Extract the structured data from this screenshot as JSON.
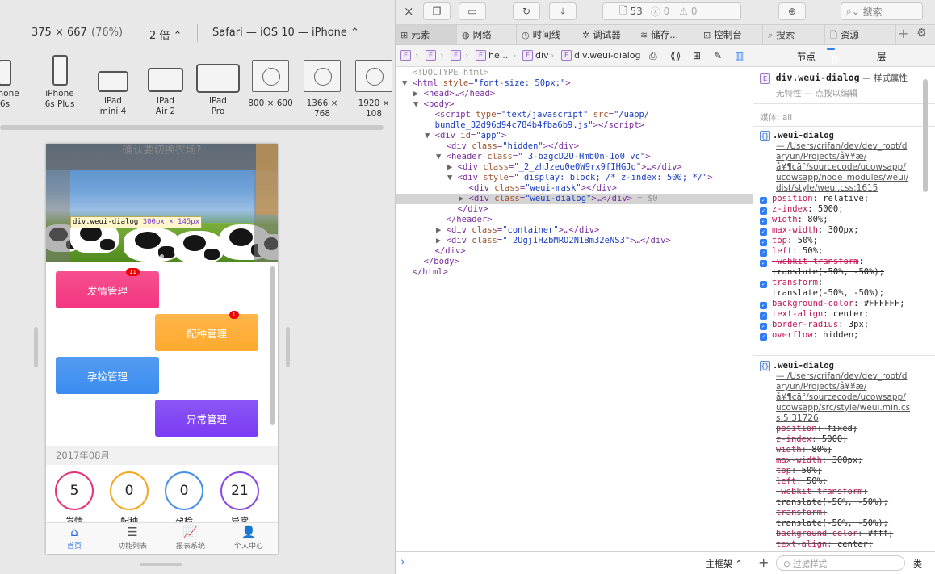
{
  "left": {
    "resolution": "375 × 667",
    "zoom_pct": "(76%)",
    "scale": "2 倍",
    "browser": "Safari — iOS 10 — iPhone",
    "devices": [
      {
        "line1": "iPhone",
        "line2": "6s"
      },
      {
        "line1": "iPhone",
        "line2": "6s Plus"
      },
      {
        "line1": "iPad",
        "line2": "mini 4"
      },
      {
        "line1": "iPad",
        "line2": "Air 2"
      },
      {
        "line1": "iPad",
        "line2": "Pro"
      },
      {
        "line1": "800 × 600",
        "line2": ""
      },
      {
        "line1": "1366 × 768",
        "line2": ""
      },
      {
        "line1": "1920 × 108",
        "line2": ""
      }
    ]
  },
  "phone": {
    "dialog_text": "确认要切换农场?",
    "highlight_tag": {
      "name": "div.weui-dialog",
      "size": "300px × 145px"
    },
    "buttons": [
      {
        "label": "发情管理",
        "badge": "11",
        "color": "#f4357f"
      },
      {
        "label": "配种管理",
        "badge": "1",
        "color": "#ffaa2e"
      },
      {
        "label": "孕检管理",
        "badge": "",
        "color": "#3a8cf0"
      },
      {
        "label": "异常管理",
        "badge": "",
        "color": "#7a3cf4"
      }
    ],
    "month": "2017年08月",
    "stats": [
      {
        "value": "5",
        "label": "发情",
        "color": "#e4357a"
      },
      {
        "value": "0",
        "label": "配种",
        "color": "#f5a623"
      },
      {
        "value": "0",
        "label": "孕检",
        "color": "#4a90e2"
      },
      {
        "value": "21",
        "label": "异常",
        "color": "#8a4ae6"
      }
    ],
    "tabs": [
      {
        "label": "首页",
        "icon": "home-icon",
        "glyph": "⌂",
        "active": true
      },
      {
        "label": "功能列表",
        "icon": "list-icon",
        "glyph": "☰",
        "active": false
      },
      {
        "label": "报表系统",
        "icon": "chart-icon",
        "glyph": "📈",
        "active": false
      },
      {
        "label": "个人中心",
        "icon": "user-icon",
        "glyph": "👤",
        "active": false
      }
    ]
  },
  "inspector": {
    "resources_count": "53",
    "errors": "0",
    "warnings": "0",
    "search_placeholder": "搜索",
    "tabs": [
      "元素",
      "网络",
      "时间线",
      "调试器",
      "储存...",
      "控制台",
      "搜索",
      "资源"
    ],
    "breadcrumbs": [
      "he...",
      "div",
      "div.weui-dialog"
    ],
    "dom_lines": [
      {
        "indent": 0,
        "tri": "",
        "html": "<span class='cm'>&lt;!DOCTYPE html&gt;</span>"
      },
      {
        "indent": 0,
        "tri": "▼",
        "html": "&lt;html <span class='att'>style</span>=<span class='val'>\"font-size: 50px;\"</span>&gt;"
      },
      {
        "indent": 1,
        "tri": "▶",
        "html": "&lt;head&gt;…&lt;/head&gt;"
      },
      {
        "indent": 1,
        "tri": "▼",
        "html": "&lt;body&gt;"
      },
      {
        "indent": 2,
        "tri": "",
        "html": "&lt;script <span class='att'>type</span>=<span class='val'>\"text/javascript\"</span> <span class='att'>src</span>=<span class='val'>\"/uapp/</span>"
      },
      {
        "indent": 2,
        "tri": "",
        "html": "<span class='val'>bundle_32d96d94c784b4fba6b9.js\"</span>&gt;&lt;/script&gt;"
      },
      {
        "indent": 2,
        "tri": "▼",
        "html": "&lt;div <span class='att'>id</span>=<span class='val'>\"app\"</span>&gt;"
      },
      {
        "indent": 3,
        "tri": "",
        "html": "&lt;div <span class='att'>class</span>=<span class='val'>\"hidden\"</span>&gt;&lt;/div&gt;"
      },
      {
        "indent": 3,
        "tri": "▼",
        "html": "&lt;header <span class='att'>class</span>=<span class='val'>\"_3-bzgcD2U-Hmb0n-1o0_vc\"</span>&gt;"
      },
      {
        "indent": 4,
        "tri": "▶",
        "html": "&lt;div <span class='att'>class</span>=<span class='val'>\"_2_zhJzeu0e0W9rx9fIHGJd\"</span>&gt;…&lt;/div&gt;"
      },
      {
        "indent": 4,
        "tri": "▼",
        "html": "&lt;div <span class='att'>style</span>=<span class='val'>\" display: block; /* z-index: 500; */\"</span>&gt;"
      },
      {
        "indent": 5,
        "tri": "",
        "html": "&lt;div <span class='att'>class</span>=<span class='val'>\"weui-mask\"</span>&gt;&lt;/div&gt;"
      },
      {
        "indent": 5,
        "tri": "▶",
        "html": "&lt;div <span class='att'>class</span>=<span class='val'>\"weui-dialog\"</span>&gt;…&lt;/div&gt; <span class='cm'>= $0</span>",
        "selected": true
      },
      {
        "indent": 4,
        "tri": "",
        "html": "&lt;/div&gt;"
      },
      {
        "indent": 3,
        "tri": "",
        "html": "&lt;/header&gt;"
      },
      {
        "indent": 3,
        "tri": "▶",
        "html": "&lt;div <span class='att'>class</span>=<span class='val'>\"container\"</span>&gt;…&lt;/div&gt;"
      },
      {
        "indent": 3,
        "tri": "▶",
        "html": "&lt;div <span class='att'>class</span>=<span class='val'>\"_2UgjIHZbMRO2N1Bm32eNS3\"</span>&gt;…&lt;/div&gt;"
      },
      {
        "indent": 2,
        "tri": "",
        "html": "&lt;/div&gt;"
      },
      {
        "indent": 1,
        "tri": "",
        "html": "&lt;/body&gt;"
      },
      {
        "indent": 0,
        "tri": "",
        "html": "&lt;/html&gt;"
      }
    ],
    "bottom_select": "主框架",
    "sidebar": {
      "tabs": [
        "节点",
        "样式",
        "层"
      ],
      "active_tab": "样式",
      "element": "div.weui-dialog",
      "element_suffix": "— 样式属性",
      "no_attrs": "无特性 — 点按以编辑",
      "media": "媒体: all",
      "rule1": {
        "selector": ".weui-dialog",
        "source": [
          "— /Users/crifan/dev/dev_root/d",
          "aryun/Projects/å¥¥æ/",
          "å¥¶cä°/sourcecode/ucowsapp/",
          "ucowsapp/node_modules/weui/",
          "dist/style/weui.css:1615"
        ],
        "props": [
          [
            "position",
            "relative;"
          ],
          [
            "z-index",
            "5000;"
          ],
          [
            "width",
            "80%;"
          ],
          [
            "max-width",
            "300px;"
          ],
          [
            "top",
            "50%;"
          ],
          [
            "left",
            "50%;"
          ],
          [
            "-webkit-transform",
            "translate(-50%, -50%);"
          ],
          [
            "transform",
            "translate(-50%, -50%);"
          ],
          [
            "background-color",
            "#FFFFFF;"
          ],
          [
            "text-align",
            "center;"
          ],
          [
            "border-radius",
            "3px;"
          ],
          [
            "overflow",
            "hidden;"
          ]
        ]
      },
      "rule2": {
        "selector": ".weui-dialog",
        "source": [
          "— /Users/crifan/dev/dev_root/d",
          "aryun/Projects/å¥¥æ/",
          "å¥¶cä°/sourcecode/ucowsapp/",
          "ucowsapp/src/style/weui.min.cs",
          "s:5:31726"
        ],
        "props": [
          [
            "position",
            "fixed;"
          ],
          [
            "z-index",
            "5000;"
          ],
          [
            "width",
            "80%;"
          ],
          [
            "max-width",
            "300px;"
          ],
          [
            "top",
            "50%;"
          ],
          [
            "left",
            "50%;"
          ],
          [
            "-webkit-transform",
            "translate(-50%, -50%);"
          ],
          [
            "transform",
            "translate(-50%, -50%);"
          ],
          [
            "background-color",
            "#fff;"
          ],
          [
            "text-align",
            "center;"
          ]
        ]
      },
      "filter_placeholder": "过滤样式",
      "class_label": "类"
    }
  }
}
